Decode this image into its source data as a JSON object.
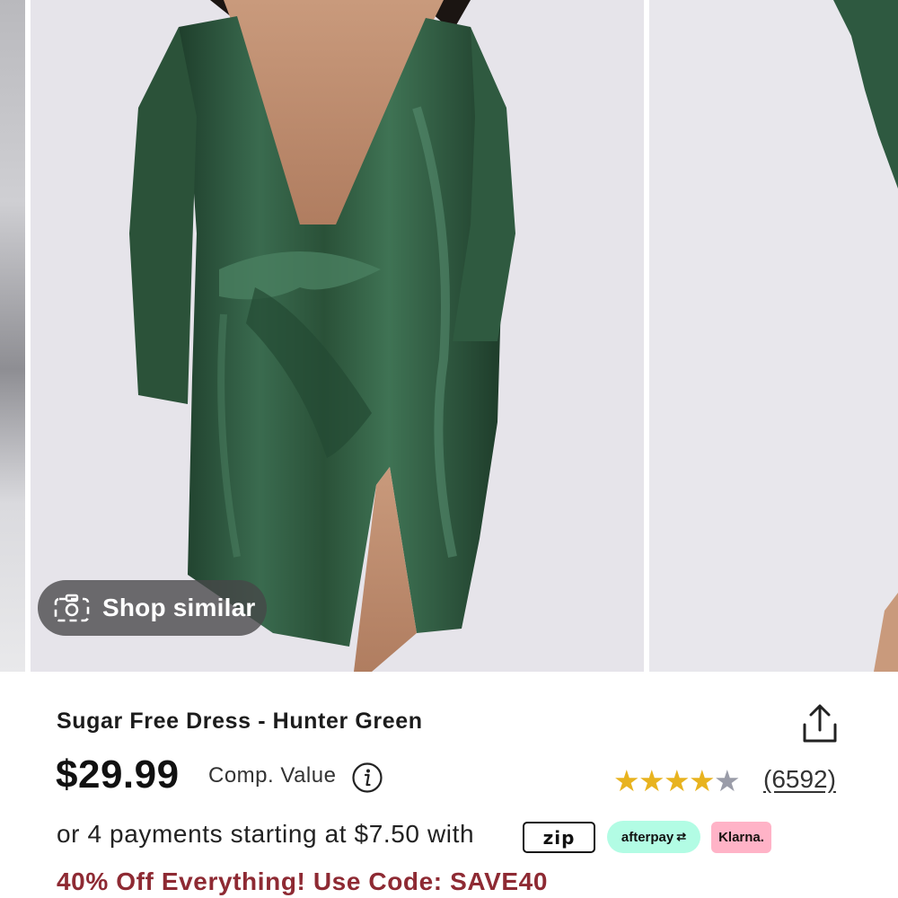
{
  "gallery": {
    "shop_similar_label": "Shop similar",
    "dress_color": "#2e5940"
  },
  "product": {
    "title": "Sugar Free Dress - Hunter Green",
    "price": "$29.99",
    "comp_value_label": "Comp. Value",
    "rating_stars": 4,
    "rating_max": 5,
    "review_count": "(6592)"
  },
  "payment": {
    "installments_text": "or 4 payments starting at $7.50 with",
    "zip_label": "zip",
    "afterpay_label": "afterpay",
    "klarna_label": "Klarna."
  },
  "promo": {
    "text": "40% Off Everything! Use Code: SAVE40",
    "color": "#8e2a33"
  },
  "icons": [
    "camera-icon",
    "share-icon",
    "info-icon",
    "star-icon"
  ]
}
